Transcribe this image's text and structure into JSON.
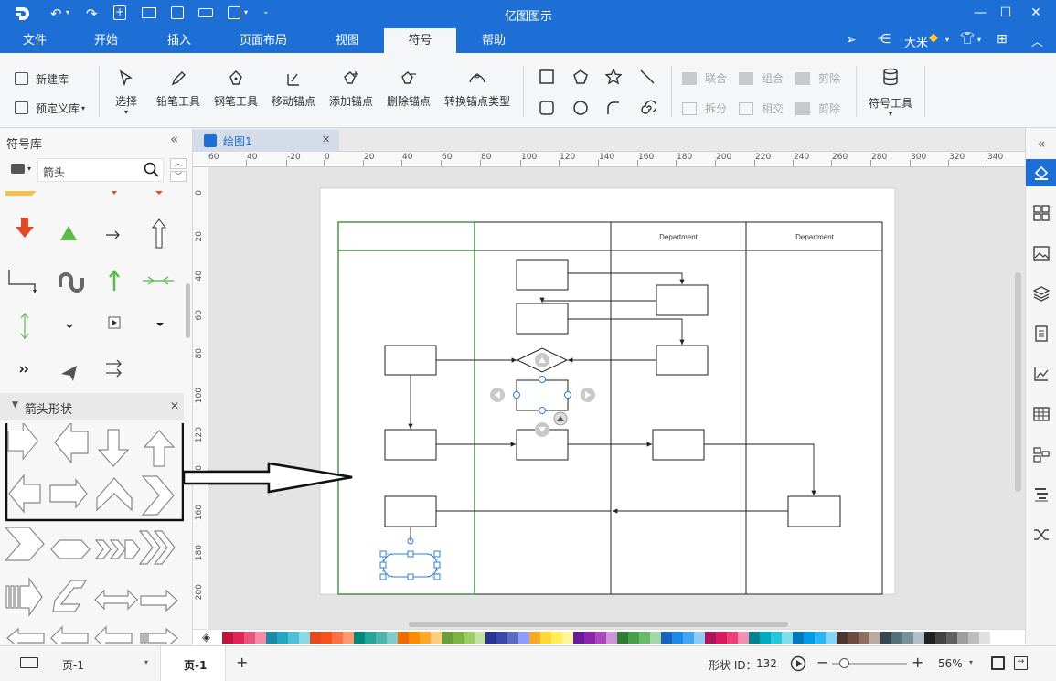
{
  "app": {
    "title": "亿图图示"
  },
  "menu": {
    "tabs": [
      "文件",
      "开始",
      "插入",
      "页面布局",
      "视图",
      "符号",
      "帮助"
    ],
    "active": "符号"
  },
  "user": {
    "name": "大米"
  },
  "ribbon": {
    "new_library": "新建库",
    "predefined_library": "预定义库",
    "select": "选择",
    "pencil_tool": "铅笔工具",
    "pen_tool": "钢笔工具",
    "move_anchor": "移动锚点",
    "add_anchor": "添加锚点",
    "delete_anchor": "删除锚点",
    "convert_anchor": "转换锚点类型",
    "union": "联合",
    "combine": "组合",
    "subtract": "剪除",
    "split": "拆分",
    "intersect": "相交",
    "cut": "剪除",
    "symbol_tools": "符号工具"
  },
  "library": {
    "title": "符号库",
    "search_value": "箭头",
    "section_title": "箭头形状"
  },
  "document": {
    "tab_name": "绘图1"
  },
  "ruler": {
    "top_labels": [
      "60",
      "40",
      "-20",
      "0",
      "20",
      "40",
      "60",
      "80",
      "100",
      "120",
      "140",
      "160",
      "180",
      "200",
      "220",
      "240",
      "260",
      "280",
      "300",
      "320",
      "340"
    ],
    "left_labels": [
      "0",
      "20",
      "40",
      "60",
      "80",
      "100",
      "120",
      "140",
      "160",
      "180",
      "200"
    ]
  },
  "diagram": {
    "lane_headers": [
      "",
      "",
      "Department",
      "Department"
    ]
  },
  "palette": {
    "colors": [
      "#c0143c",
      "#e0245a",
      "#e8557a",
      "#f28ca8",
      "#1e88a8",
      "#26a5c0",
      "#4cc2d4",
      "#8ad8e4",
      "#e64a19",
      "#f4511e",
      "#ff7043",
      "#ff9a70",
      "#00897b",
      "#26a69a",
      "#4db6ac",
      "#80cbc4",
      "#ef6c00",
      "#fb8c00",
      "#ffa726",
      "#ffcc80",
      "#689f38",
      "#7cb342",
      "#9ccc65",
      "#c5e1a5",
      "#283593",
      "#3949ab",
      "#5c6bc0",
      "#8c9eff",
      "#f9a825",
      "#fdd835",
      "#ffee58",
      "#fff59d",
      "#6a1b9a",
      "#8e24aa",
      "#ab47bc",
      "#ce93d8",
      "#2e7d32",
      "#43a047",
      "#66bb6a",
      "#a5d6a7",
      "#1565c0",
      "#1e88e5",
      "#42a5f5",
      "#90caf9",
      "#ad1457",
      "#d81b60",
      "#ec407a",
      "#f48fb1",
      "#00838f",
      "#00acc1",
      "#26c6da",
      "#80deea",
      "#0277bd",
      "#039be5",
      "#29b6f6",
      "#81d4fa",
      "#4e342e",
      "#6d4c41",
      "#8d6e63",
      "#bcaaa4",
      "#37474f",
      "#546e7a",
      "#78909c",
      "#b0bec5",
      "#212121",
      "#424242",
      "#616161",
      "#9e9e9e",
      "#bdbdbd",
      "#e0e0e0"
    ]
  },
  "status": {
    "page_selector": "页-1",
    "page_tab": "页-1",
    "shape_id_label": "形状 ID：",
    "shape_id": "132",
    "zoom": "56%"
  }
}
